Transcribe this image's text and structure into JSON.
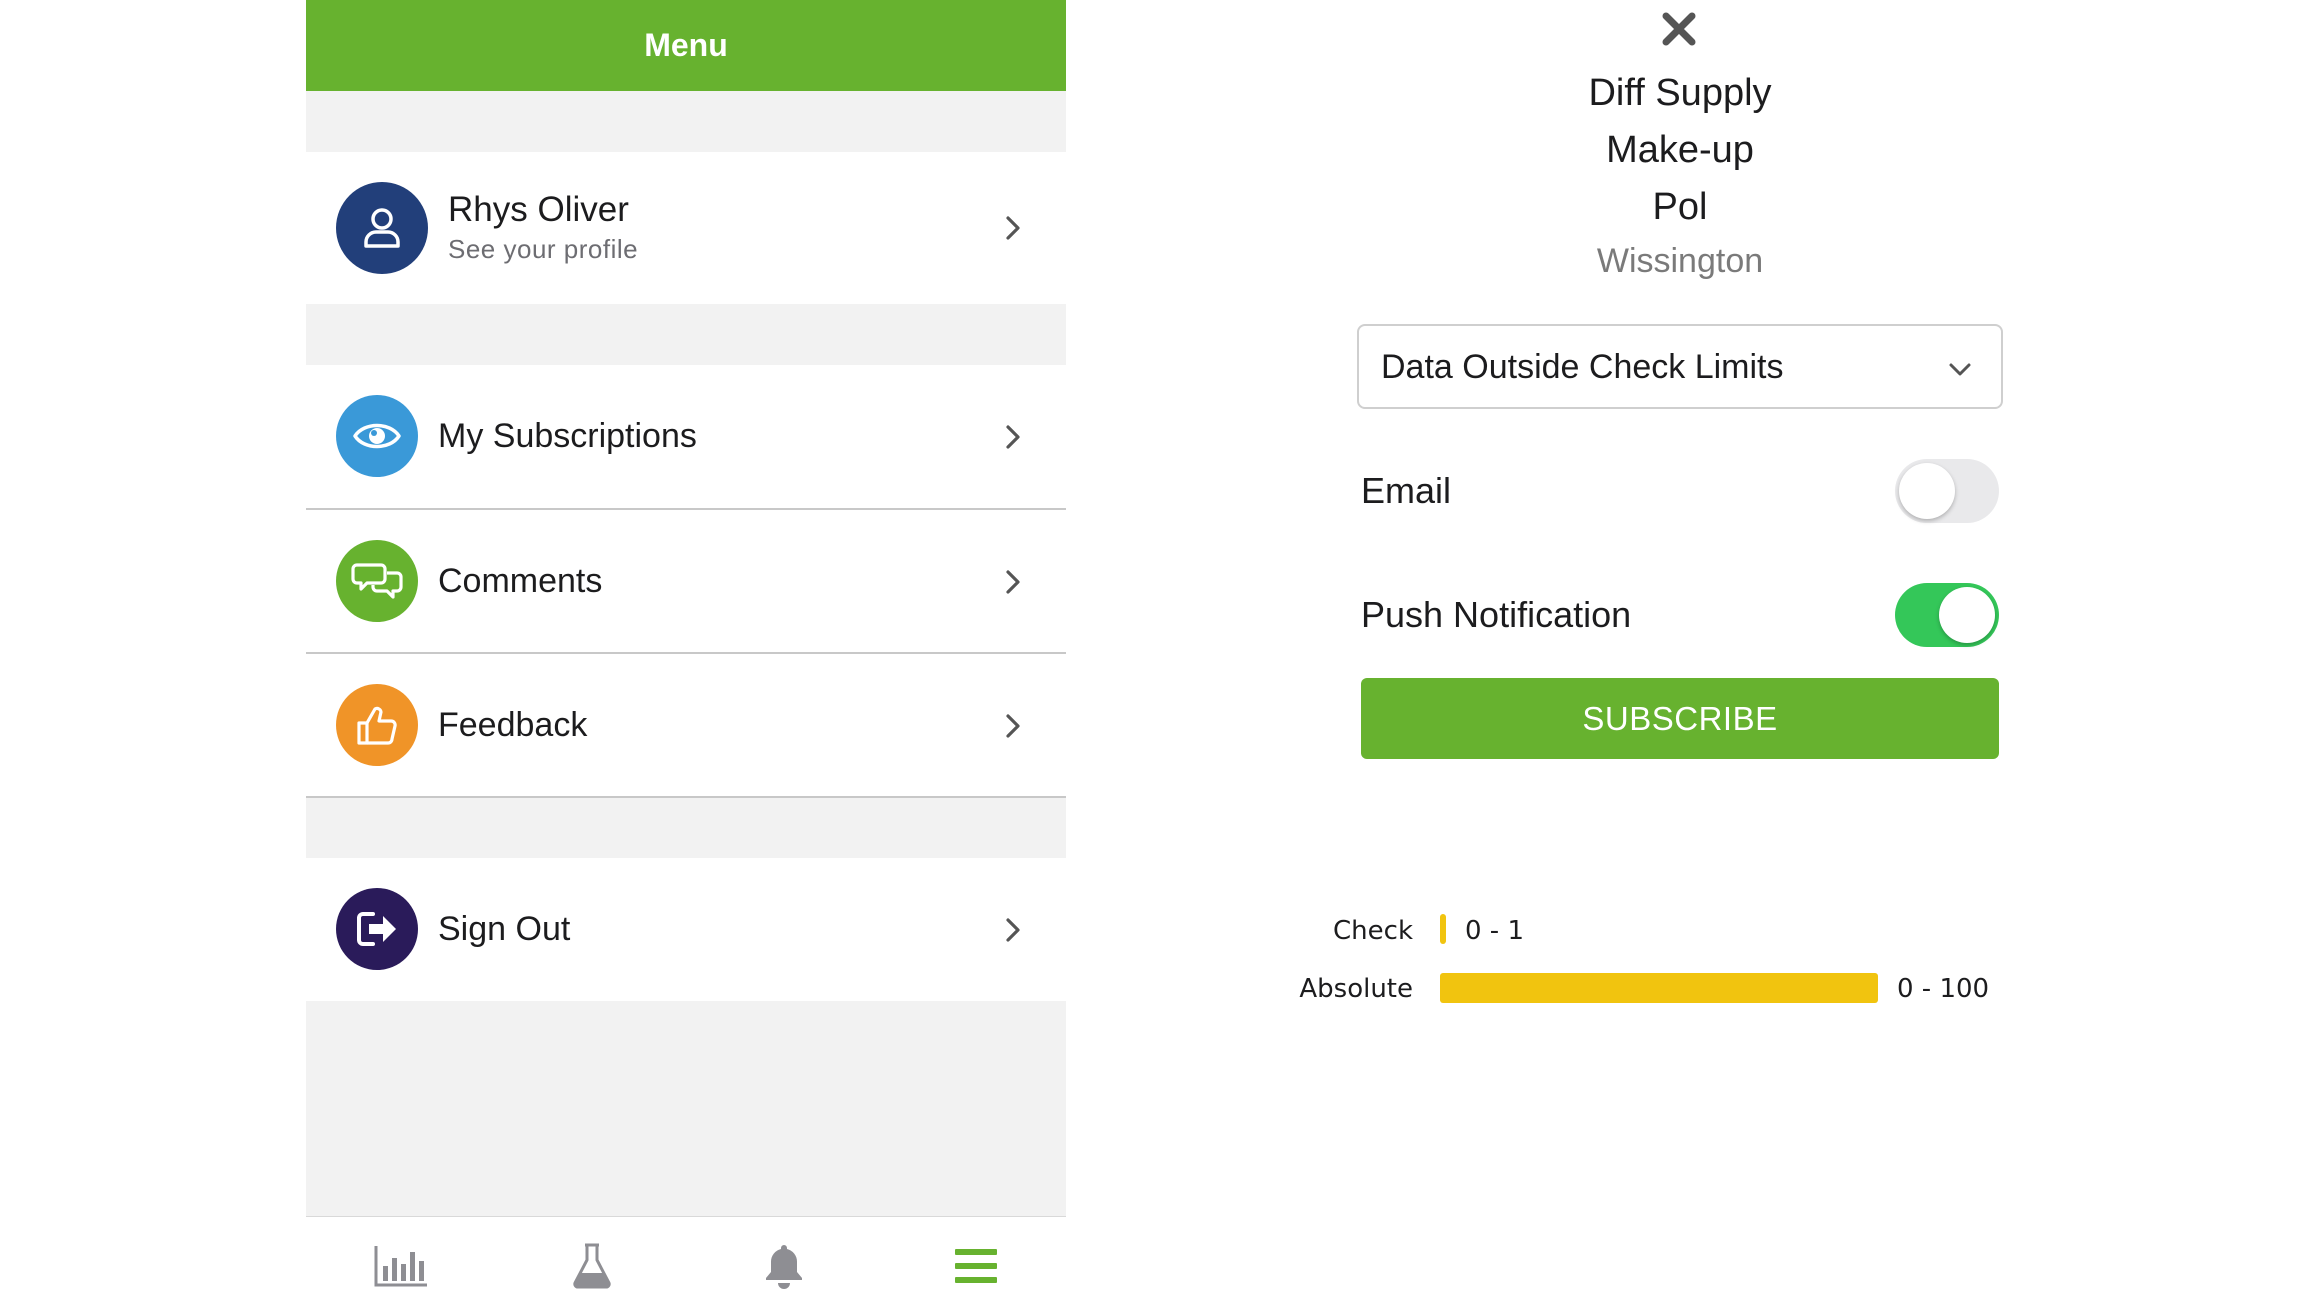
{
  "menu": {
    "header_title": "Menu",
    "profile": {
      "name": "Rhys Oliver",
      "subtitle": "See your profile",
      "icon": "person-icon"
    },
    "items": [
      {
        "label": "My Subscriptions",
        "icon": "eye-icon",
        "color": "#3a99d8"
      },
      {
        "label": "Comments",
        "icon": "comments-icon",
        "color": "#67b22f"
      },
      {
        "label": "Feedback",
        "icon": "thumbs-up-icon",
        "color": "#f09428"
      }
    ],
    "sign_out": {
      "label": "Sign Out",
      "icon": "sign-out-icon",
      "color": "#2a1b5a"
    }
  },
  "tabbar": {
    "tabs": [
      {
        "icon": "bar-chart-icon",
        "active": false
      },
      {
        "icon": "flask-icon",
        "active": false
      },
      {
        "icon": "bell-icon",
        "active": false
      },
      {
        "icon": "hamburger-menu-icon",
        "active": true
      }
    ],
    "active_color": "#67b22f",
    "inactive_color": "#8e8e93"
  },
  "subscription": {
    "title_lines": [
      "Diff Supply",
      "Make-up",
      "Pol"
    ],
    "location": "Wissington",
    "alert_type": "Data Outside Check Limits",
    "email": {
      "label": "Email",
      "enabled": false
    },
    "push": {
      "label": "Push Notification",
      "enabled": true
    },
    "subscribe_label": "SUBSCRIBE",
    "limits": [
      {
        "label": "Check",
        "range": "0 - 1",
        "min": 0,
        "max": 1,
        "color": "#f1c40f"
      },
      {
        "label": "Absolute",
        "range": "0 - 100",
        "min": 0,
        "max": 100,
        "color": "#f1c40f"
      }
    ]
  },
  "brand_color": "#67b22f"
}
